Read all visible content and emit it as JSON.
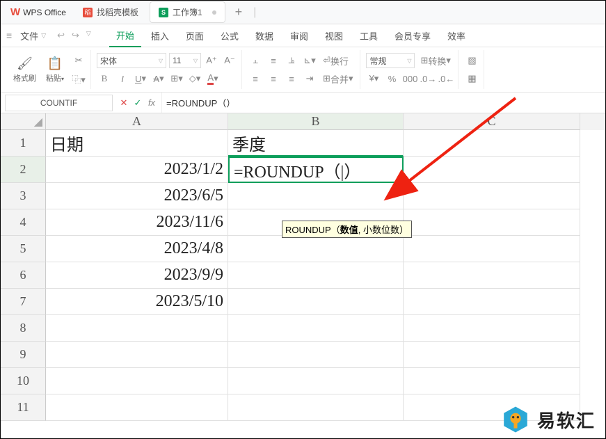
{
  "app": {
    "name": "WPS Office"
  },
  "tabs": [
    {
      "icon": "稻",
      "label": "找稻壳模板"
    },
    {
      "icon": "S",
      "label": "工作簿1"
    }
  ],
  "menubar": {
    "file": "文件",
    "items": [
      "开始",
      "插入",
      "页面",
      "公式",
      "数据",
      "审阅",
      "视图",
      "工具",
      "会员专享",
      "效率"
    ],
    "active_index": 0
  },
  "ribbon": {
    "format_brush": "格式刷",
    "paste": "粘贴",
    "font": "宋体",
    "font_size": "11",
    "wrap": "换行",
    "merge": "合并",
    "number_format": "常规",
    "convert": "转换"
  },
  "formula_bar": {
    "cell_ref": "COUNTIF",
    "formula": "=ROUNDUP（）"
  },
  "sheet": {
    "columns": [
      "A",
      "B",
      "C"
    ],
    "rows": [
      "1",
      "2",
      "3",
      "4",
      "5",
      "6",
      "7",
      "8",
      "9",
      "10",
      "11"
    ],
    "cells": {
      "A1": "日期",
      "B1": "季度",
      "A2": "2023/1/2",
      "B2": "=ROUNDUP（|）",
      "A3": "2023/6/5",
      "A4": "2023/11/6",
      "A5": "2023/4/8",
      "A6": "2023/9/9",
      "A7": "2023/5/10"
    }
  },
  "tooltip": {
    "fn": "ROUNDUP",
    "open": "（",
    "arg1": "数值",
    "sep": ", ",
    "arg2": "小数位数",
    "close": "）"
  },
  "watermark": "易软汇"
}
